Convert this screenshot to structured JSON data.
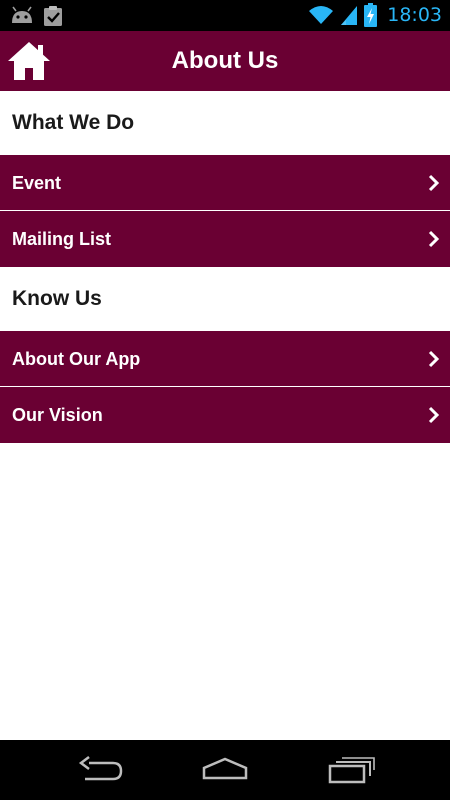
{
  "status_bar": {
    "time": "18:03",
    "icons": [
      "android-icon",
      "clipboard-check-icon",
      "wifi-icon",
      "signal-icon",
      "battery-charging-icon"
    ]
  },
  "app_bar": {
    "title": "About Us",
    "home_icon": "home-icon"
  },
  "sections": [
    {
      "title": "What We Do",
      "items": [
        {
          "label": "Event"
        },
        {
          "label": "Mailing List"
        }
      ]
    },
    {
      "title": "Know Us",
      "items": [
        {
          "label": "About Our App"
        },
        {
          "label": "Our Vision"
        }
      ]
    }
  ],
  "colors": {
    "primary": "#6a0033",
    "clock": "#29b6f6",
    "background": "#ffffff"
  },
  "nav_bar": {
    "icons": [
      "back-icon",
      "home-nav-icon",
      "recent-apps-icon"
    ]
  }
}
